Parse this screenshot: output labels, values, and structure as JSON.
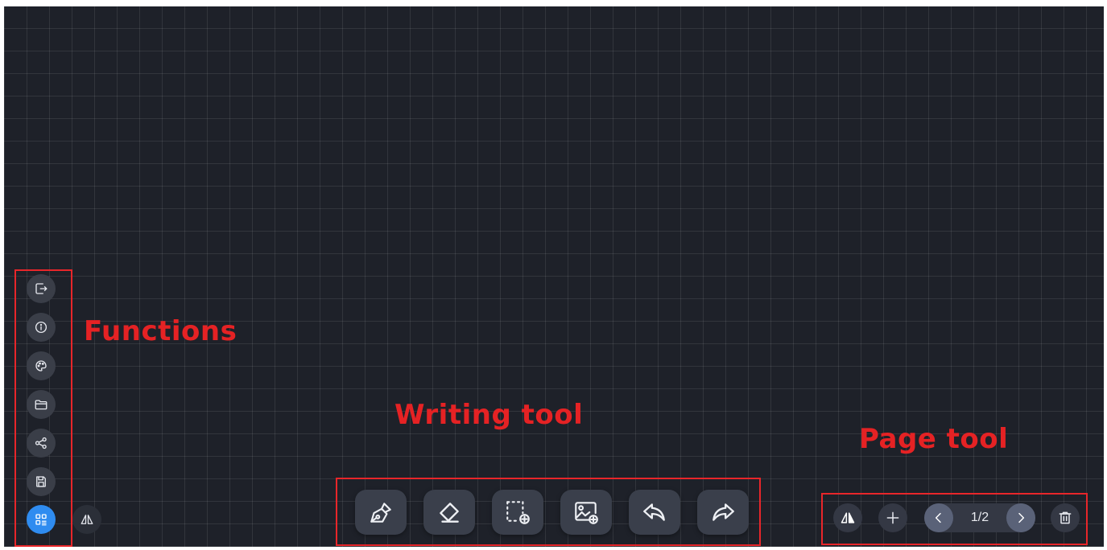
{
  "annotations": {
    "functions": "Functions",
    "writing_tool": "Writing tool",
    "page_tool": "Page tool"
  },
  "colors": {
    "canvas_background": "#1e2129",
    "annotation_red": "#e52224",
    "active_blue": "#2f8cf0"
  },
  "functions_panel": {
    "items": [
      {
        "icon": "exit-icon"
      },
      {
        "icon": "info-icon"
      },
      {
        "icon": "palette-icon"
      },
      {
        "icon": "folder-icon"
      },
      {
        "icon": "share-icon"
      },
      {
        "icon": "save-icon"
      },
      {
        "icon": "menu-grid-icon",
        "active": true
      }
    ],
    "mirror_toggle_icon": "mirror-toggle-icon"
  },
  "writing_toolbar": {
    "tools": [
      {
        "icon": "pen-icon"
      },
      {
        "icon": "eraser-icon"
      },
      {
        "icon": "select-icon"
      },
      {
        "icon": "insert-image-icon"
      },
      {
        "icon": "undo-icon"
      },
      {
        "icon": "redo-icon"
      }
    ]
  },
  "page_toolbar": {
    "current_page_text": "1/2",
    "tools": [
      {
        "icon": "mirror-toggle-icon"
      },
      {
        "icon": "add-page-icon"
      },
      {
        "icon": "prev-page-icon"
      },
      {
        "icon": "next-page-icon"
      },
      {
        "icon": "delete-page-icon"
      }
    ]
  }
}
